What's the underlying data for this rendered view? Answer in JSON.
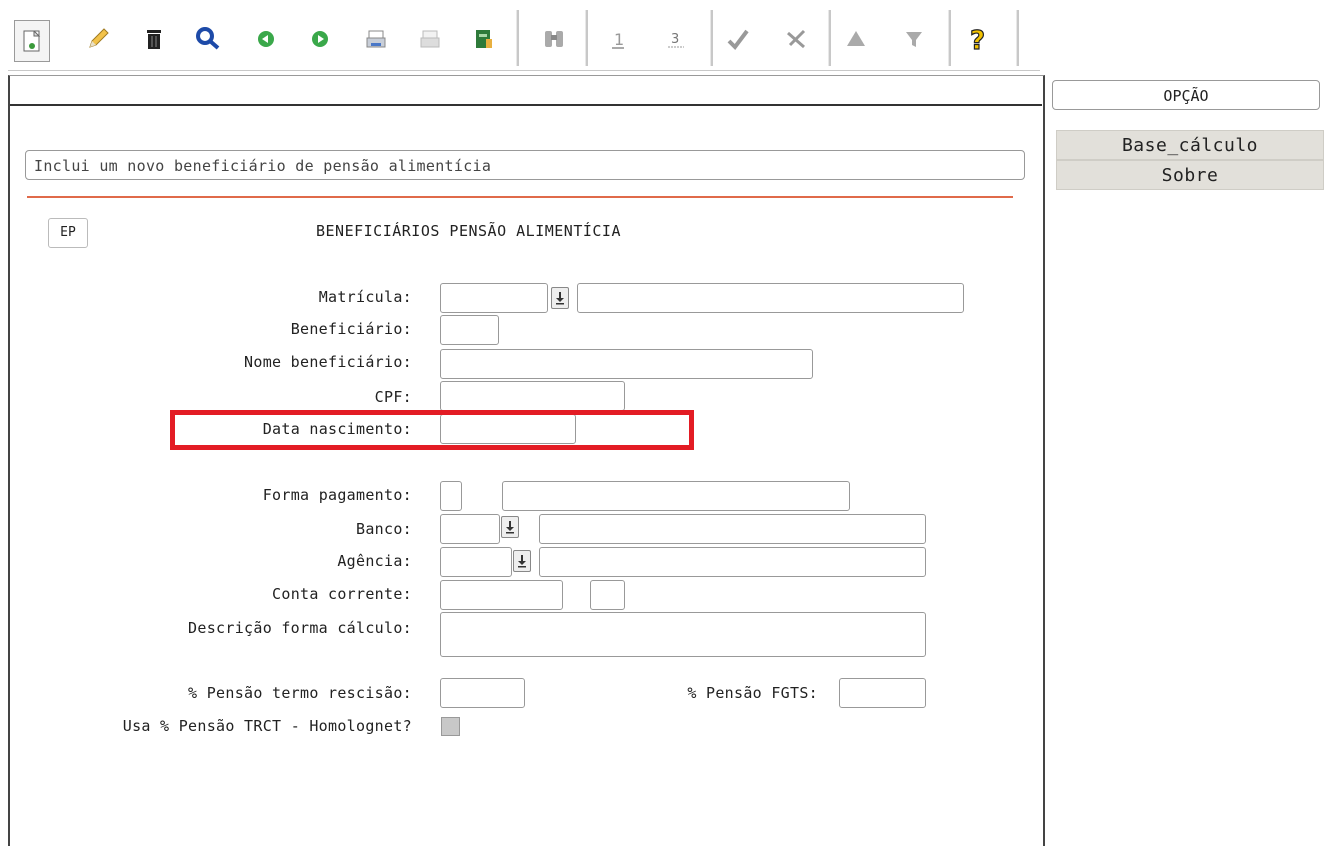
{
  "toolbar": {
    "icons": [
      "new-icon",
      "edit-icon",
      "delete-icon",
      "search-icon",
      "previous-icon",
      "next-icon",
      "print-icon",
      "print-disabled-icon",
      "export-icon",
      "find-disabled-icon",
      "first-icon",
      "sum-icon",
      "confirm-icon",
      "tools-icon",
      "up-icon",
      "filter-icon",
      "help-icon"
    ]
  },
  "message": "Inclui um novo beneficiário de pensão alimentícia",
  "ep_label": "EP",
  "form_title": "BENEFICIÁRIOS PENSÃO ALIMENTÍCIA",
  "fields": {
    "matricula": "Matrícula:",
    "beneficiario": "Beneficiário:",
    "nome_beneficiario": "Nome beneficiário:",
    "cpf": "CPF:",
    "data_nascimento": "Data nascimento:",
    "forma_pagamento": "Forma pagamento:",
    "banco": "Banco:",
    "agencia": "Agência:",
    "conta_corrente": "Conta corrente:",
    "descricao_forma_calculo": "Descrição forma cálculo:",
    "pensao_termo_rescisao": "% Pensão termo rescisão:",
    "pensao_fgts": "% Pensão FGTS:",
    "usa_pensao_trct": "Usa % Pensão TRCT - Homolognet?"
  },
  "sidebar": {
    "opcao": "OPÇÃO",
    "buttons": [
      "Base_cálculo",
      "Sobre"
    ]
  },
  "colors": {
    "highlight": "#e31c24",
    "rule": "#e06a4a",
    "button_bg": "#e2e0da"
  }
}
